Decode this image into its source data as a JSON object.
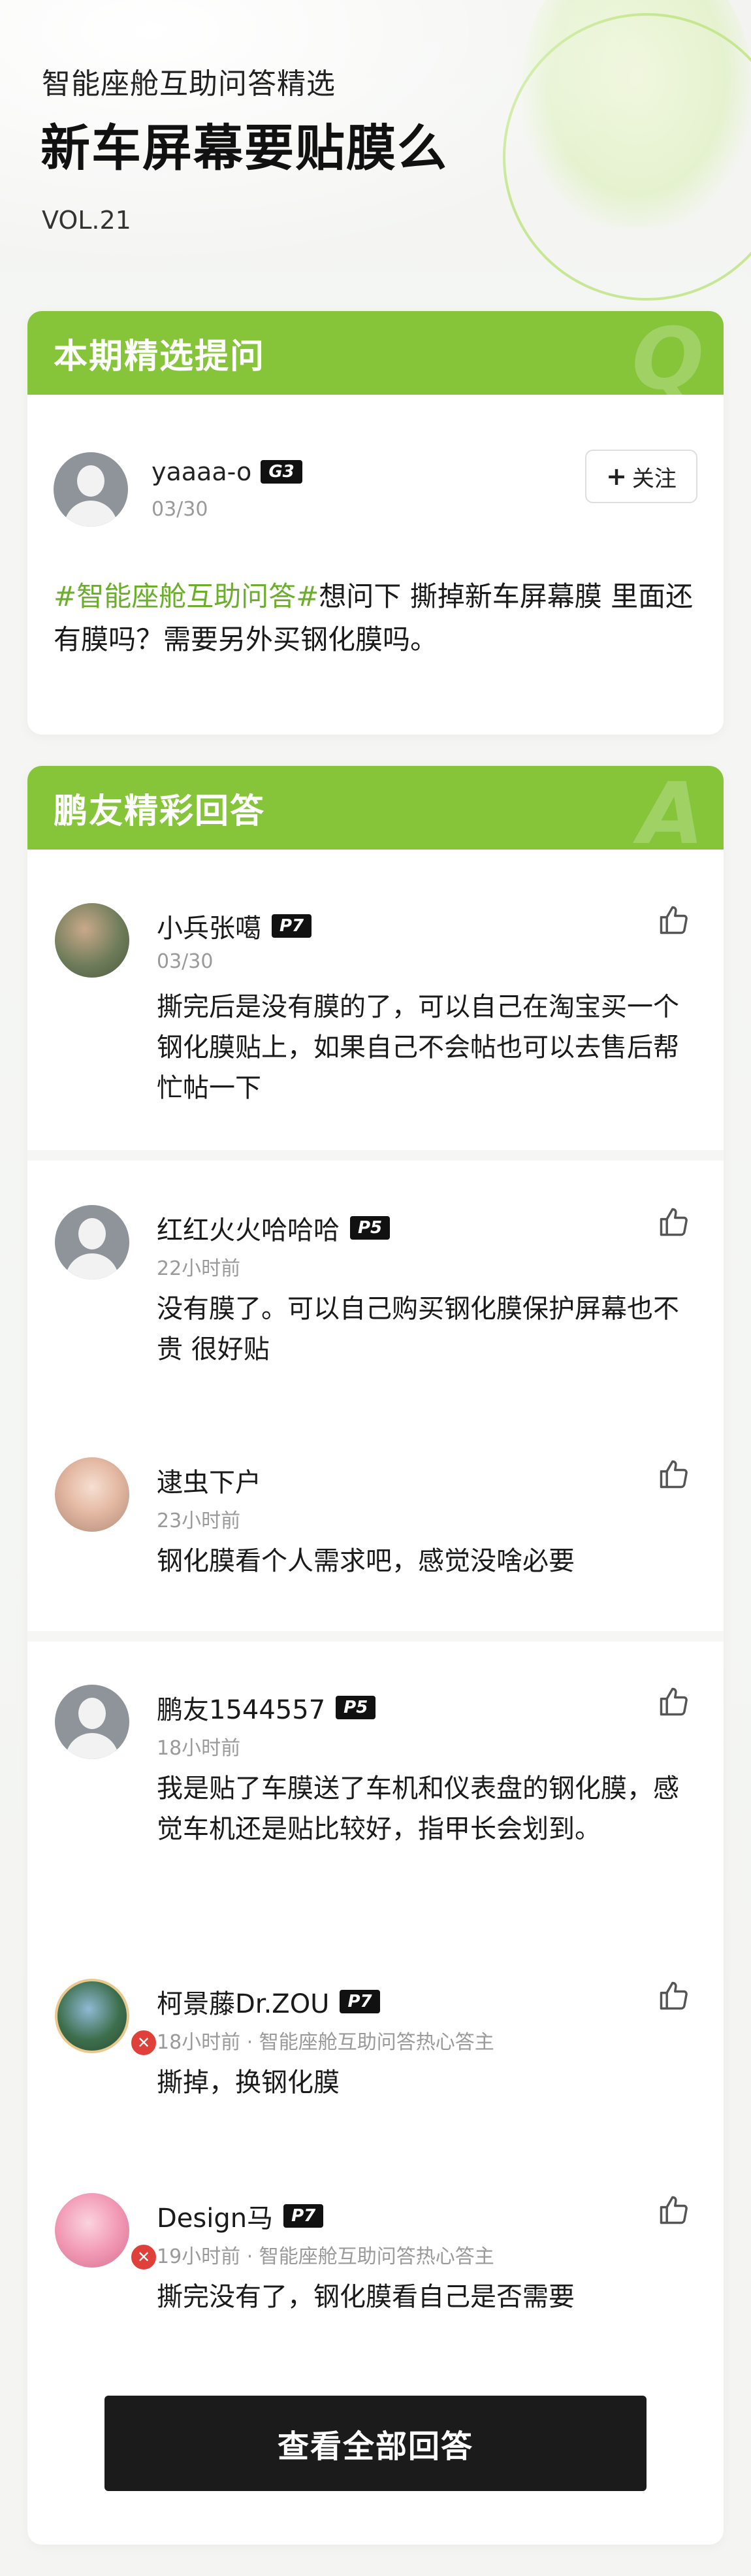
{
  "header": {
    "subtitle": "智能座舱互助问答精选",
    "title": "新车屏幕要贴膜么",
    "volume": "VOL.21"
  },
  "question_section": {
    "title": "本期精选提问",
    "mark": "Q",
    "user": {
      "name": "yaaaa-o",
      "level": "G3",
      "date": "03/30"
    },
    "follow_label": "关注",
    "hashtag": "#智能座舱互助问答#",
    "text": "想问下 撕掉新车屏幕膜 里面还有膜吗？需要另外买钢化膜吗。"
  },
  "answers_section": {
    "title": "鹏友精彩回答",
    "mark": "A",
    "answers": [
      {
        "name": "小兵张噶",
        "level": "P7",
        "meta": "03/30",
        "text": "撕完后是没有膜的了，可以自己在淘宝买一个钢化膜贴上，如果自己不会帖也可以去售后帮忙帖一下"
      },
      {
        "name": "红红火火哈哈哈",
        "level": "P5",
        "meta": "22小时前",
        "text": "没有膜了。可以自己购买钢化膜保护屏幕也不贵 很好贴"
      },
      {
        "name": "逮虫下户",
        "level": "",
        "meta": "23小时前",
        "text": "钢化膜看个人需求吧，感觉没啥必要"
      },
      {
        "name": "鹏友1544557",
        "level": "P5",
        "meta": "18小时前",
        "text": "我是贴了车膜送了车机和仪表盘的钢化膜，感觉车机还是贴比较好，指甲长会划到。"
      },
      {
        "name": "柯景藤Dr.ZOU",
        "level": "P7",
        "meta": "18小时前 · 智能座舱互助问答热心答主",
        "text": "撕掉，换钢化膜"
      },
      {
        "name": "Design马",
        "level": "P7",
        "meta": "19小时前 · 智能座舱互助问答热心答主",
        "text": "撕完没有了，钢化膜看自己是否需要"
      }
    ],
    "view_all_label": "查看全部回答"
  },
  "colors": {
    "accent": "#86c43a",
    "hashtag": "#6cae2c",
    "badge": "#111111",
    "button": "#1b1b1b"
  }
}
